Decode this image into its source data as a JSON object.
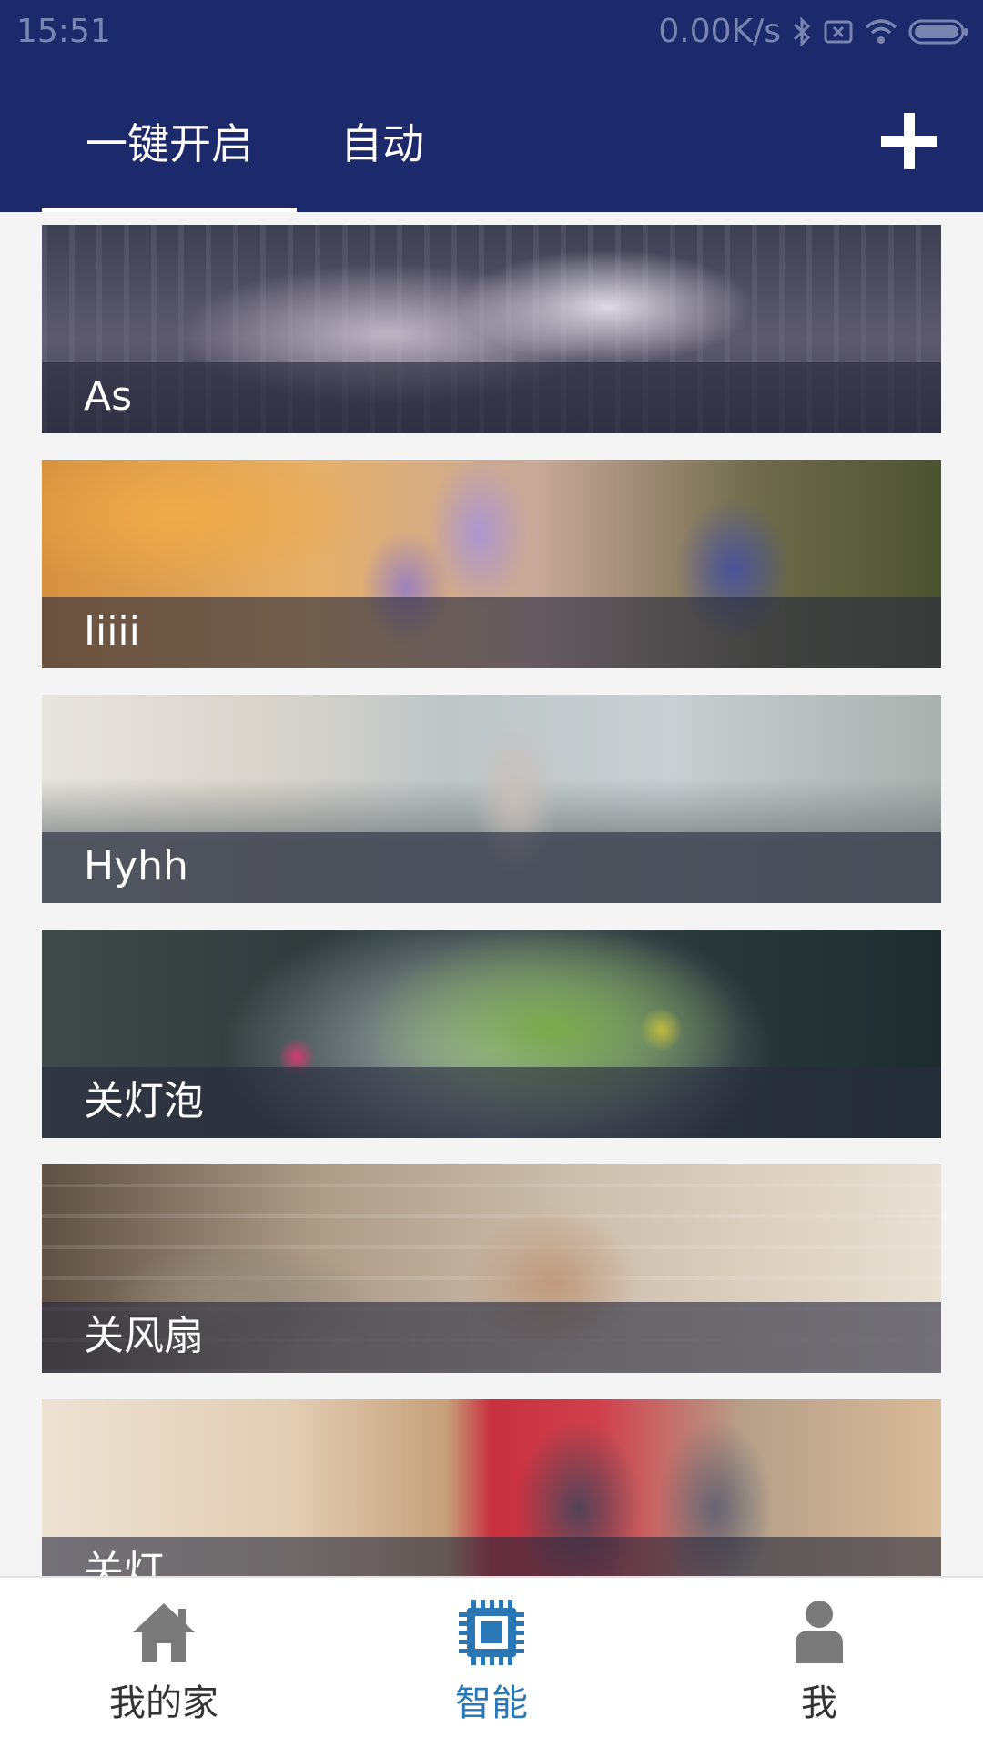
{
  "status_bar": {
    "time": "15:51",
    "network_speed": "0.00K/s",
    "icons": [
      "bluetooth-icon",
      "no-sim-icon",
      "wifi-icon",
      "battery-icon"
    ]
  },
  "header": {
    "tabs": [
      {
        "label": "一键开启",
        "active": true
      },
      {
        "label": "自动",
        "active": false
      }
    ],
    "add_icon": "plus-icon"
  },
  "scenes": [
    {
      "label": "As",
      "image": "bedroom-sleeping-photo"
    },
    {
      "label": "Iiiii",
      "image": "purple-flowers-sunset-photo"
    },
    {
      "label": "Hyhh",
      "image": "woman-by-window-photo"
    },
    {
      "label": "关灯泡",
      "image": "salad-bowl-photo"
    },
    {
      "label": "关风扇",
      "image": "family-reading-on-sofa-photo"
    },
    {
      "label": "关灯",
      "image": "kids-running-through-door-photo"
    }
  ],
  "bottom_nav": {
    "items": [
      {
        "label": "我的家",
        "icon": "home-icon",
        "active": false
      },
      {
        "label": "智能",
        "icon": "chip-icon",
        "active": true
      },
      {
        "label": "我",
        "icon": "person-icon",
        "active": false
      }
    ]
  },
  "colors": {
    "header_bg": "#1c2a6b",
    "active_nav": "#2a77b6",
    "inactive_nav_icon": "#7a7a7a",
    "page_bg": "#f4f4f4"
  }
}
